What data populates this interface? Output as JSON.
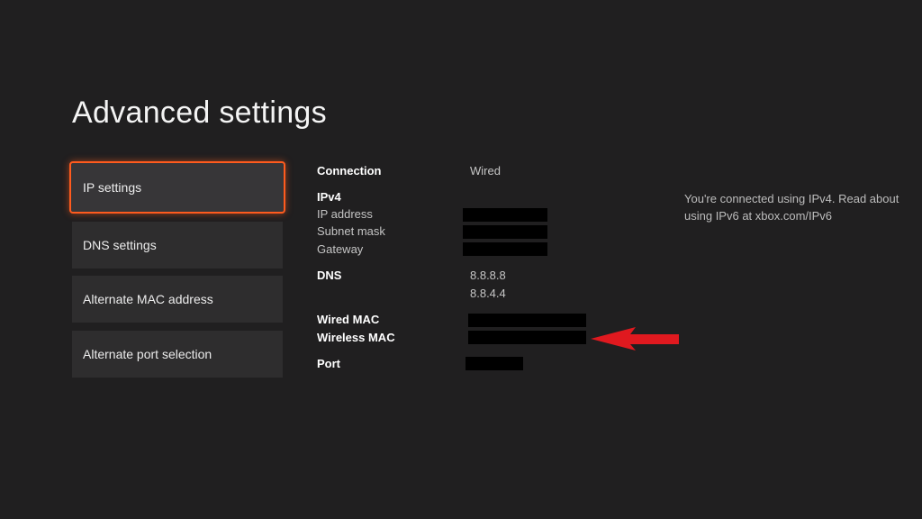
{
  "page": {
    "title": "Advanced settings"
  },
  "menu": {
    "items": [
      {
        "label": "IP settings",
        "selected": true
      },
      {
        "label": "DNS settings",
        "selected": false
      },
      {
        "label": "Alternate MAC address",
        "selected": false
      },
      {
        "label": "Alternate port selection",
        "selected": false
      }
    ]
  },
  "details": {
    "connection": {
      "label": "Connection",
      "value": "Wired"
    },
    "ipv4": {
      "heading": "IPv4",
      "ip_address_label": "IP address",
      "subnet_mask_label": "Subnet mask",
      "gateway_label": "Gateway"
    },
    "dns": {
      "label": "DNS",
      "primary": "8.8.8.8",
      "secondary": "8.8.4.4"
    },
    "wired_mac_label": "Wired MAC",
    "wireless_mac_label": "Wireless MAC",
    "port_label": "Port"
  },
  "info_text": "You're connected using IPv4. Read about using IPv6 at xbox.com/IPv6",
  "colors": {
    "background": "#201f20",
    "focus_accent": "#ff5b1e",
    "arrow": "#e0191f"
  }
}
